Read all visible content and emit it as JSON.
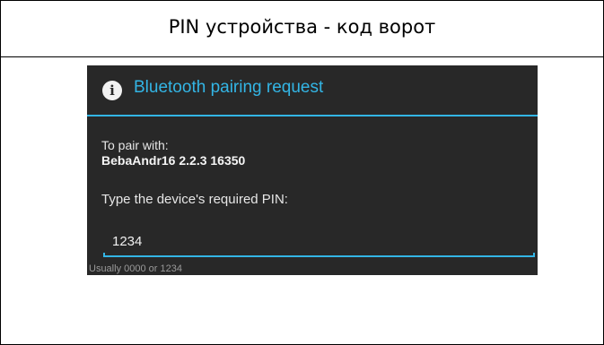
{
  "header": {
    "title": "PIN устройства - код ворот"
  },
  "dialog": {
    "icon": "info-icon",
    "title": "Bluetooth pairing request",
    "pair_with_label": "To pair with:",
    "device_name": "BebaAndr16 2.2.3 16350",
    "pin_prompt": "Type the device's required PIN:",
    "pin_value": "1234",
    "pin_hint": "Usually 0000 or 1234",
    "accent_color": "#33b5e5",
    "background_color": "#282828"
  }
}
